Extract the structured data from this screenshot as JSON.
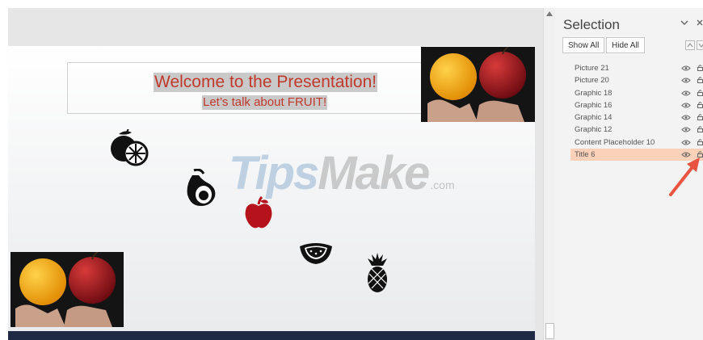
{
  "selection_pane": {
    "title": "Selection",
    "show_all_label": "Show All",
    "hide_all_label": "Hide All",
    "layers": [
      {
        "label": "Picture 21",
        "selected": false
      },
      {
        "label": "Picture 20",
        "selected": false
      },
      {
        "label": "Graphic 18",
        "selected": false
      },
      {
        "label": "Graphic 16",
        "selected": false
      },
      {
        "label": "Graphic 14",
        "selected": false
      },
      {
        "label": "Graphic 12",
        "selected": false
      },
      {
        "label": "Content Placeholder 10",
        "selected": false
      },
      {
        "label": "Title 6",
        "selected": true
      }
    ]
  },
  "slide": {
    "title_line1": "Welcome to the Presentation!",
    "title_line2": "Let’s talk about FRUIT!"
  },
  "watermark": {
    "brand_tips": "Tips",
    "brand_make": "Make",
    "brand_com": ".com"
  },
  "colors": {
    "title_text": "#c0392b",
    "selected_row": "#fbd1b9",
    "annotation_arrow": "#e8543f",
    "apple_icon": "#b5121b",
    "slide_bottom_bar": "#1f2a44"
  },
  "icons": [
    "lemon-icon",
    "avocado-icon",
    "apple-icon",
    "watermelon-icon",
    "pineapple-icon",
    "eye-icon",
    "lock-icon",
    "chevron-down-icon",
    "close-icon"
  ]
}
